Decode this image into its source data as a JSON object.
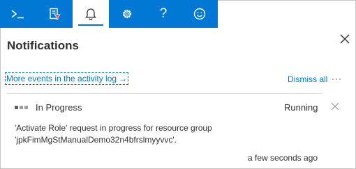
{
  "toolbar": {
    "buttons": [
      {
        "name": "cloud-shell",
        "icon": "terminal-prompt-icon"
      },
      {
        "name": "directory-filter",
        "icon": "directory-filter-icon"
      },
      {
        "name": "notifications",
        "icon": "bell-icon",
        "active": true
      },
      {
        "name": "settings",
        "icon": "gear-icon"
      },
      {
        "name": "help",
        "icon": "question-icon",
        "label": "?"
      },
      {
        "name": "feedback",
        "icon": "smiley-icon"
      }
    ],
    "accent_color": "#0078d4"
  },
  "panel": {
    "title": "Notifications",
    "activity_log_link": "More events in the activity log",
    "activity_log_arrow": "→",
    "dismiss_all": "Dismiss all",
    "more_options": "···"
  },
  "notification": {
    "status": "In Progress",
    "state": "Running",
    "message": "'Activate Role' request in progress for resource group 'jpkFimMgStManualDemo32n4bfrslmyyvvc'.",
    "timestamp": "a few seconds ago"
  }
}
